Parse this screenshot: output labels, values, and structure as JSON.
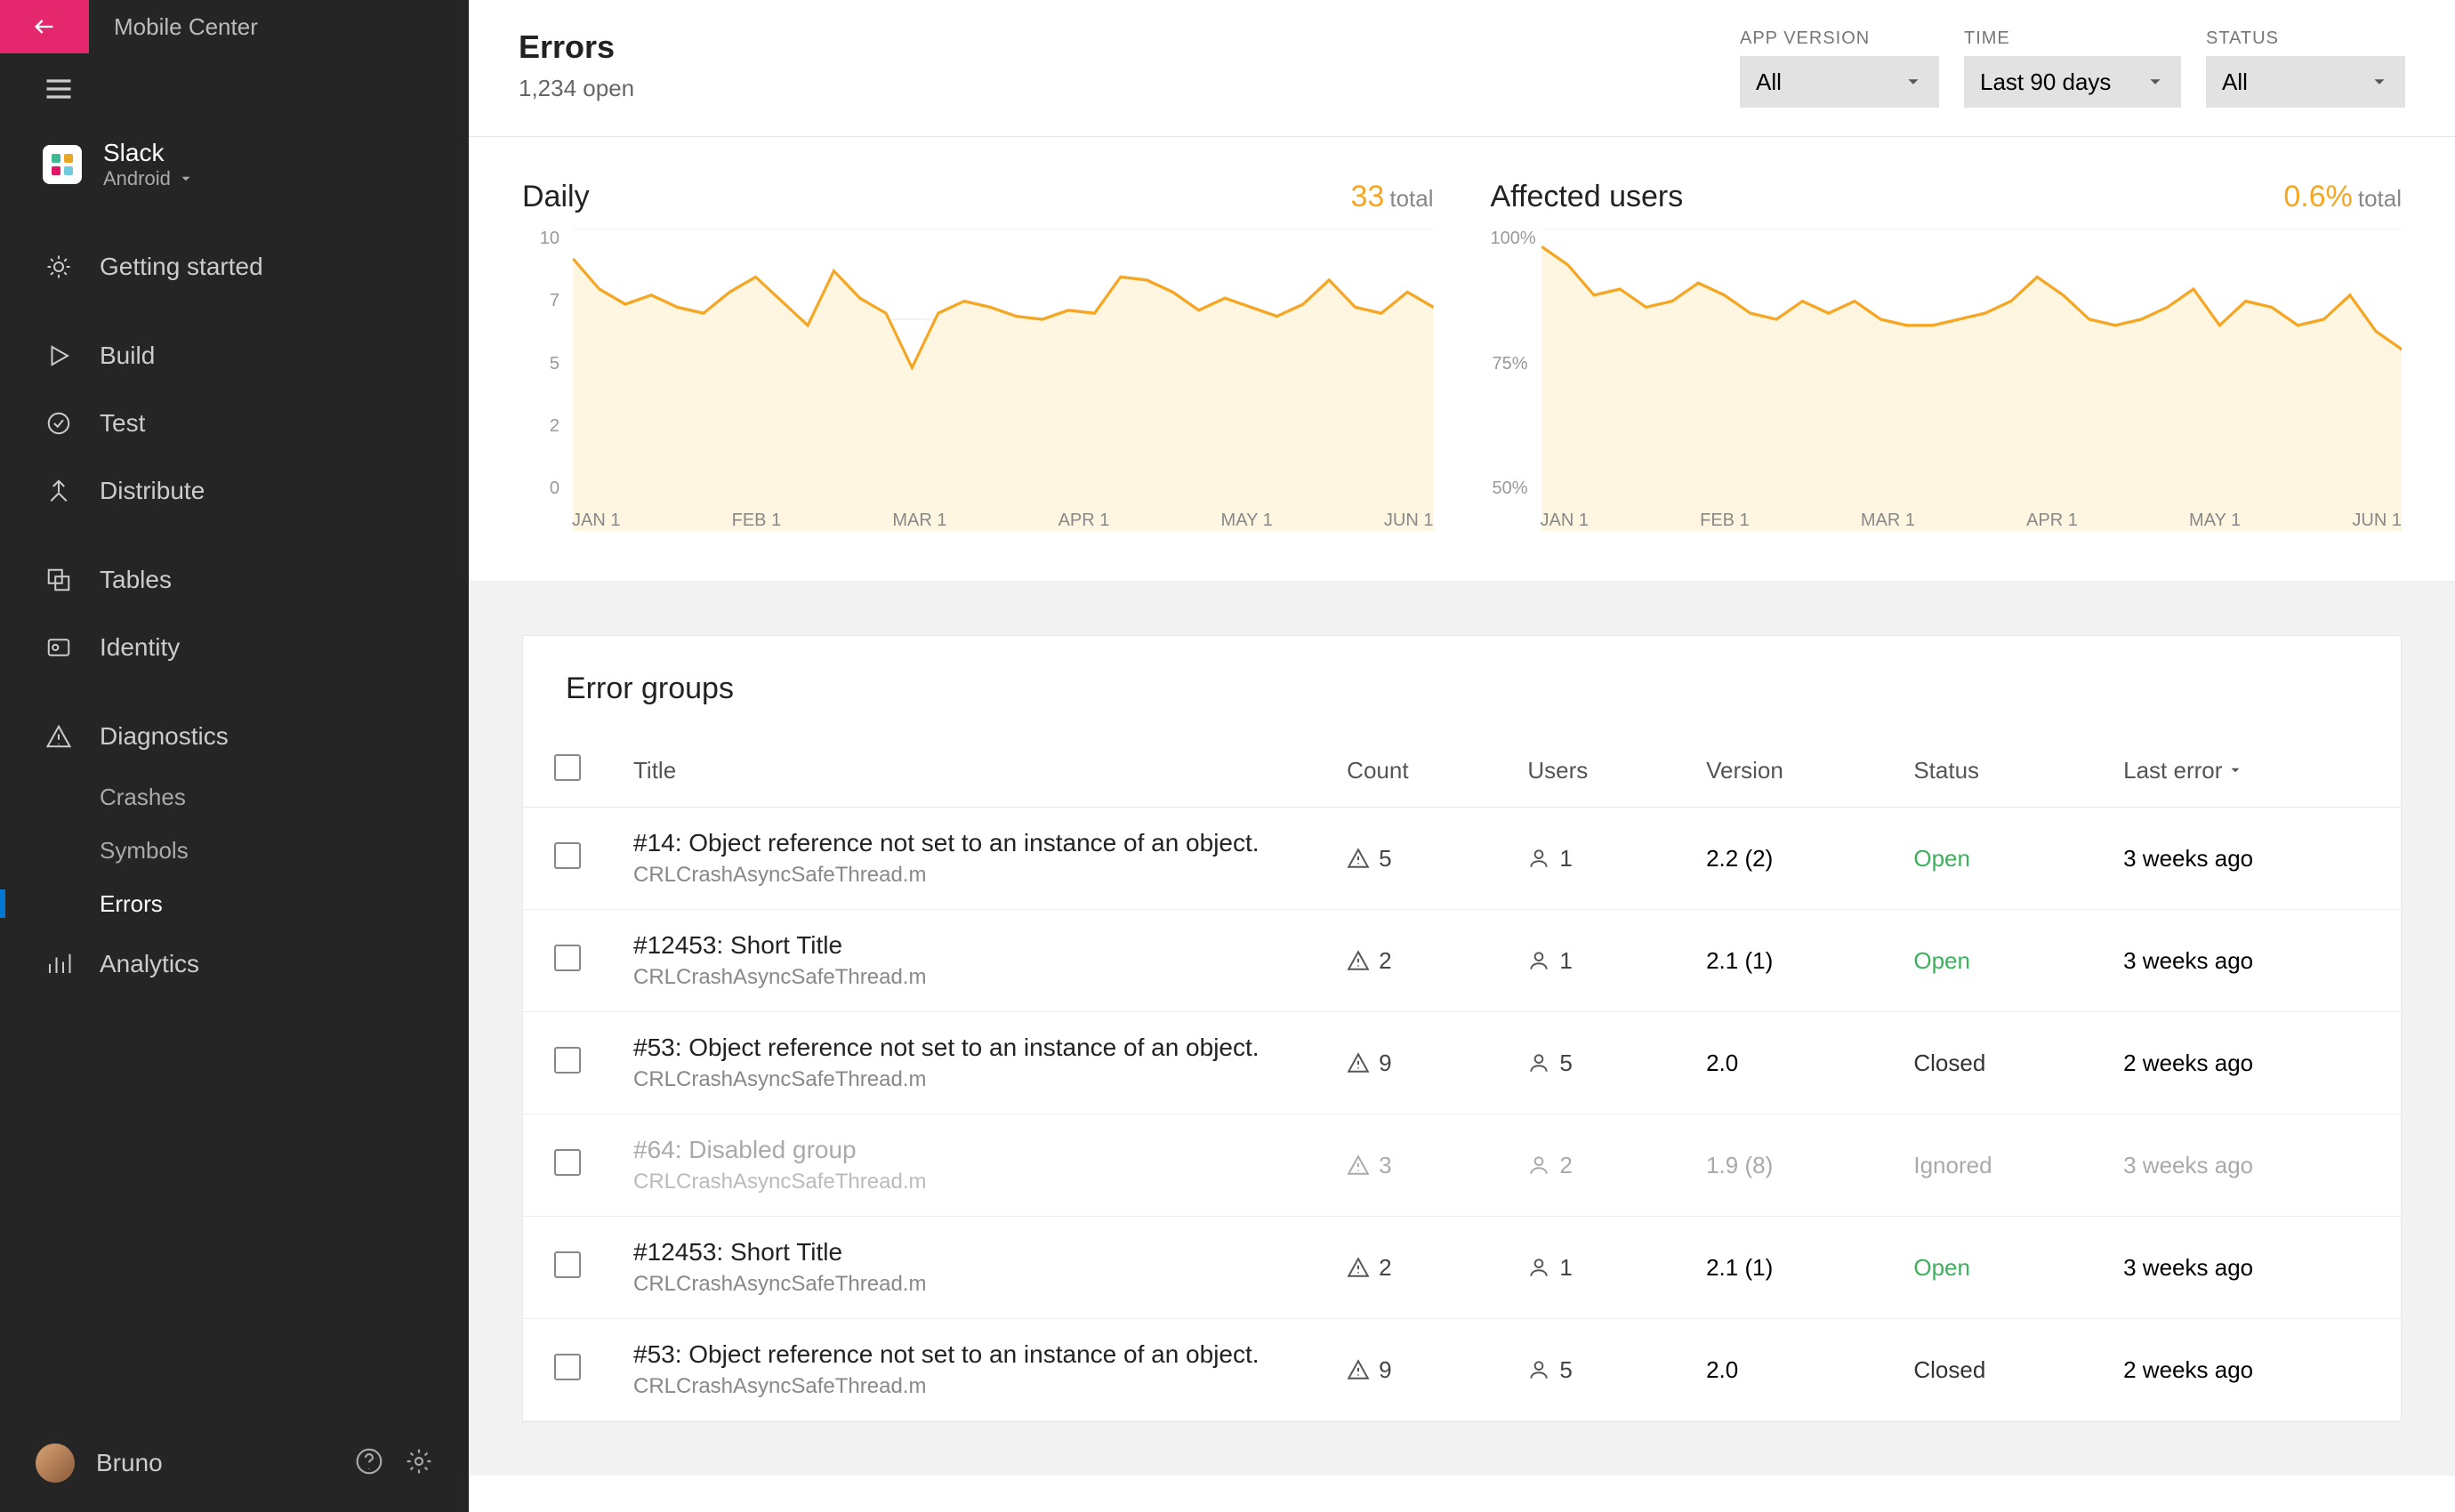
{
  "app": {
    "title": "Mobile Center",
    "name": "Slack",
    "platform": "Android"
  },
  "sidebar": {
    "items": {
      "getting_started": "Getting started",
      "build": "Build",
      "test": "Test",
      "distribute": "Distribute",
      "tables": "Tables",
      "identity": "Identity",
      "diagnostics": "Diagnostics",
      "analytics": "Analytics"
    },
    "sub": {
      "crashes": "Crashes",
      "symbols": "Symbols",
      "errors": "Errors"
    }
  },
  "user": {
    "name": "Bruno"
  },
  "header": {
    "title": "Errors",
    "subtitle": "1,234 open",
    "filters": {
      "app_version_label": "APP VERSION",
      "app_version_value": "All",
      "time_label": "TIME",
      "time_value": "Last 90 days",
      "status_label": "STATUS",
      "status_value": "All"
    }
  },
  "charts": {
    "daily": {
      "title": "Daily",
      "value": "33",
      "unit": "total"
    },
    "affected": {
      "title": "Affected users",
      "value": "0.6%",
      "unit": "total"
    }
  },
  "chart_data": [
    {
      "type": "area",
      "title": "Daily",
      "ylabel": "",
      "xlabel": "",
      "ylim": [
        0,
        10
      ],
      "y_ticks": [
        "10",
        "7",
        "5",
        "2",
        "0"
      ],
      "x_ticks": [
        "JAN 1",
        "FEB 1",
        "MAR 1",
        "APR 1",
        "MAY 1",
        "JUN 1"
      ],
      "values": [
        9,
        8,
        7.5,
        7.8,
        7.4,
        7.2,
        7.9,
        8.4,
        7.6,
        6.8,
        8.6,
        7.7,
        7.2,
        5.4,
        7.2,
        7.6,
        7.4,
        7.1,
        7.0,
        7.3,
        7.2,
        8.4,
        8.3,
        7.9,
        7.3,
        7.7,
        7.4,
        7.1,
        7.5,
        8.3,
        7.4,
        7.2,
        7.9,
        7.4
      ]
    },
    {
      "type": "area",
      "title": "Affected users",
      "ylabel": "",
      "xlabel": "",
      "ylim": [
        50,
        100
      ],
      "y_ticks": [
        "100%",
        "75%",
        "50%"
      ],
      "x_ticks": [
        "JAN 1",
        "FEB 1",
        "MAR 1",
        "APR 1",
        "MAY 1",
        "JUN 1"
      ],
      "values": [
        97,
        94,
        89,
        90,
        87,
        88,
        91,
        89,
        86,
        85,
        88,
        86,
        88,
        85,
        84,
        84,
        85,
        86,
        88,
        92,
        89,
        85,
        84,
        85,
        87,
        90,
        84,
        88,
        87,
        84,
        85,
        89,
        83,
        80
      ]
    }
  ],
  "groups": {
    "title": "Error groups",
    "columns": {
      "title": "Title",
      "count": "Count",
      "users": "Users",
      "version": "Version",
      "status": "Status",
      "last": "Last error"
    },
    "rows": [
      {
        "title": "#14: Object reference not set to an instance of an object.",
        "sub": "CRLCrashAsyncSafeThread.m",
        "count": "5",
        "users": "1",
        "version": "2.2 (2)",
        "status": "Open",
        "status_class": "open",
        "last": "3 weeks ago",
        "muted": false
      },
      {
        "title": "#12453: Short Title",
        "sub": "CRLCrashAsyncSafeThread.m",
        "count": "2",
        "users": "1",
        "version": "2.1 (1)",
        "status": "Open",
        "status_class": "open",
        "last": "3 weeks ago",
        "muted": false
      },
      {
        "title": "#53: Object reference not set to an instance of an object.",
        "sub": "CRLCrashAsyncSafeThread.m",
        "count": "9",
        "users": "5",
        "version": "2.0",
        "status": "Closed",
        "status_class": "closed",
        "last": "2 weeks ago",
        "muted": false
      },
      {
        "title": "#64: Disabled group",
        "sub": "CRLCrashAsyncSafeThread.m",
        "count": "3",
        "users": "2",
        "version": "1.9 (8)",
        "status": "Ignored",
        "status_class": "ignored",
        "last": "3 weeks ago",
        "muted": true
      },
      {
        "title": "#12453: Short Title",
        "sub": "CRLCrashAsyncSafeThread.m",
        "count": "2",
        "users": "1",
        "version": "2.1 (1)",
        "status": "Open",
        "status_class": "open",
        "last": "3 weeks ago",
        "muted": false
      },
      {
        "title": "#53: Object reference not set to an instance of an object.",
        "sub": "CRLCrashAsyncSafeThread.m",
        "count": "9",
        "users": "5",
        "version": "2.0",
        "status": "Closed",
        "status_class": "closed",
        "last": "2 weeks ago",
        "muted": false
      }
    ]
  }
}
